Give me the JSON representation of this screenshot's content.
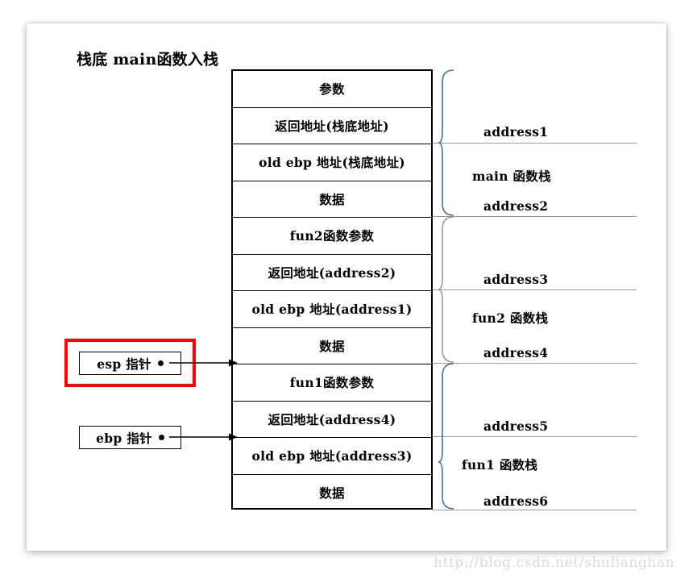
{
  "title": "栈底 main函数入栈",
  "watermark": "http://blog.csdn.net/shulianghan",
  "colors": {
    "brace_blue": "#4a6f9e",
    "brace_gray": "#9a9a9a",
    "highlight_red": "#ff0000",
    "border_black": "#000000",
    "section_line_gray": "#9a9a9a",
    "watermark_gray": "#d9d9d9"
  },
  "stack_rows": [
    {
      "label": "参数"
    },
    {
      "label": "返回地址(栈底地址)"
    },
    {
      "label": "old ebp 地址(栈底地址)"
    },
    {
      "label": "数据"
    },
    {
      "label": "fun2函数参数"
    },
    {
      "label": "返回地址(address2)"
    },
    {
      "label": "old ebp 地址(address1)"
    },
    {
      "label": "数据"
    },
    {
      "label": "fun1函数参数"
    },
    {
      "label": "返回地址(address4)"
    },
    {
      "label": "old ebp 地址(address3)"
    },
    {
      "label": "数据"
    }
  ],
  "side_labels": [
    {
      "text": "address1"
    },
    {
      "text": "main 函数栈"
    },
    {
      "text": "address2"
    },
    {
      "text": "address3"
    },
    {
      "text": "fun2 函数栈"
    },
    {
      "text": "address4"
    },
    {
      "text": "address5"
    },
    {
      "text": "fun1 函数栈"
    },
    {
      "text": "address6"
    }
  ],
  "pointers": [
    {
      "label": "esp 指针",
      "highlighted": true
    },
    {
      "label": "ebp 指针",
      "highlighted": false
    }
  ]
}
